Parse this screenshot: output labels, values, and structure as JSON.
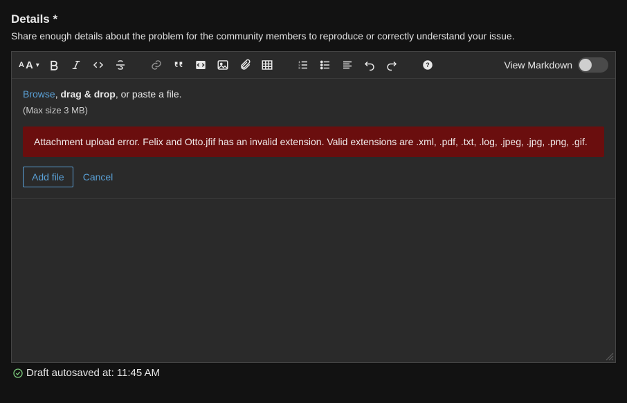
{
  "header": {
    "title": "Details *",
    "subtitle": "Share enough details about the problem for the community members to reproduce or correctly understand your issue."
  },
  "toolbar": {
    "view_markdown_label": "View Markdown",
    "view_markdown_on": false
  },
  "dropzone": {
    "browse": "Browse",
    "drag": "drag & drop",
    "paste_suffix": ", or paste a file.",
    "max_size": "(Max size 3 MB)",
    "error": "Attachment upload error. Felix and Otto.jfif has an invalid extension. Valid extensions are .xml, .pdf, .txt, .log, .jpeg, .jpg, .png, .gif.",
    "add_file": "Add file",
    "cancel": "Cancel"
  },
  "footer": {
    "autosave_prefix": "Draft autosaved at: ",
    "autosave_time": "11:45 AM"
  }
}
